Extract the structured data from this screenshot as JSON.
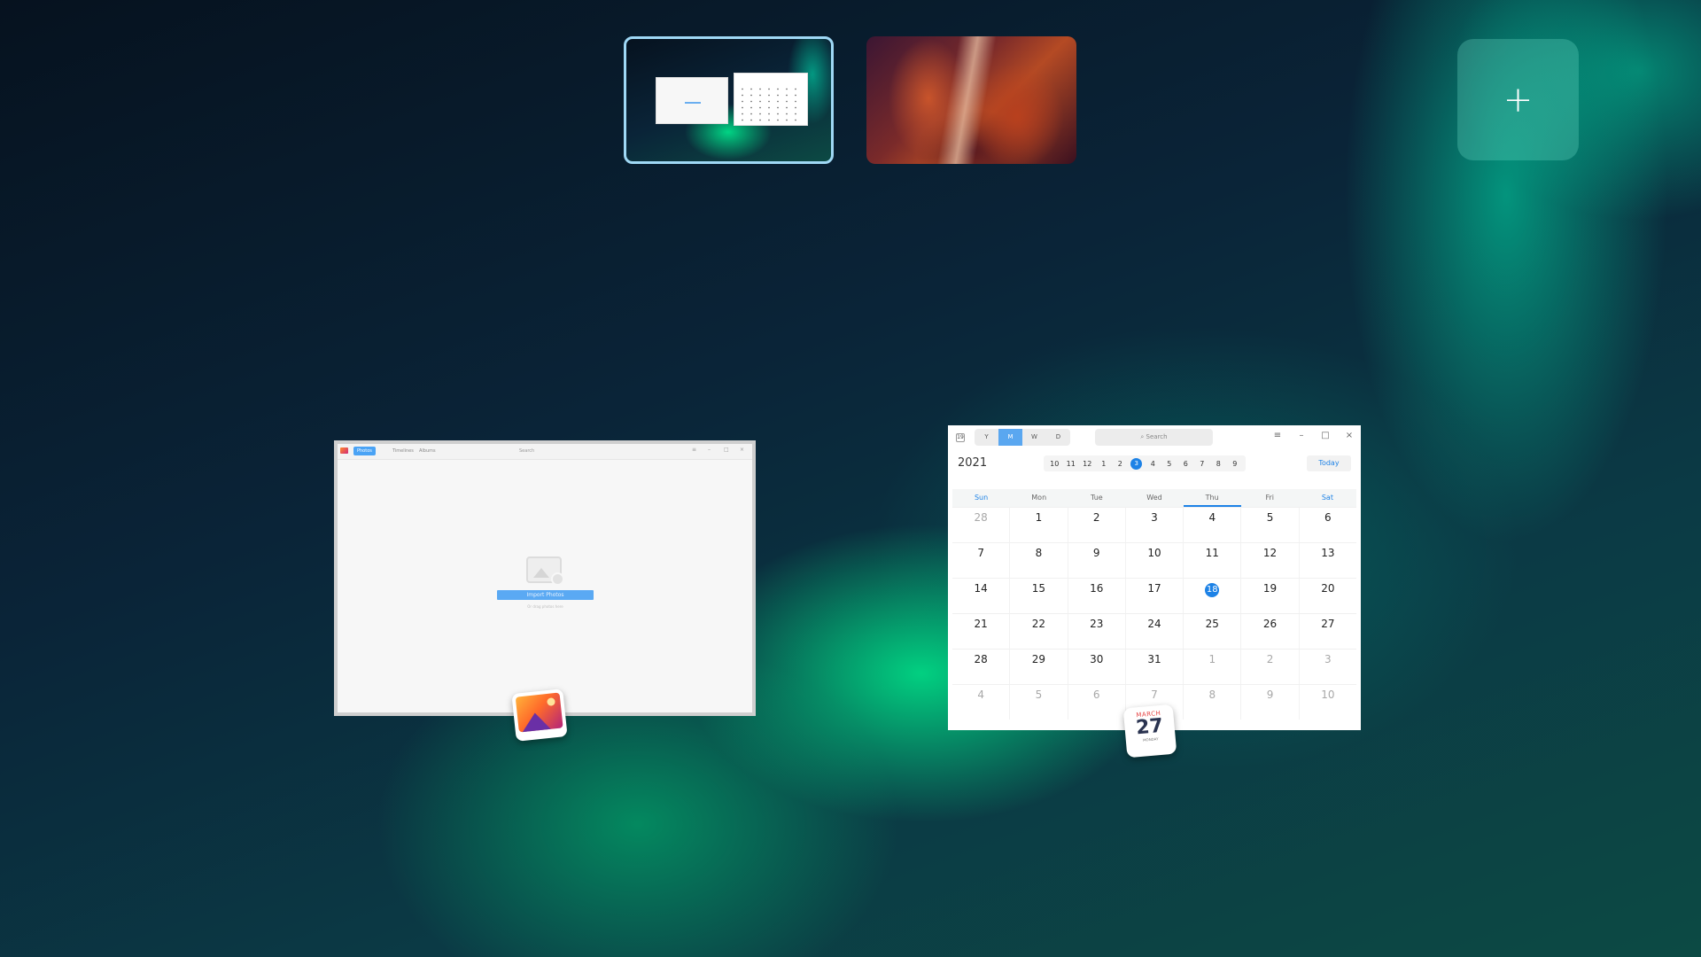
{
  "workspaces": {
    "add_label": "+"
  },
  "album": {
    "tabs": [
      "Photos",
      "Timelines",
      "Albums"
    ],
    "search_placeholder": "Search",
    "import_label": "Import Photos",
    "hint": "Or drag photos here",
    "controls": [
      "≡",
      "–",
      "□",
      "×"
    ]
  },
  "calendar": {
    "logo": "19",
    "views": [
      "Y",
      "M",
      "W",
      "D"
    ],
    "active_view": "M",
    "search_placeholder": "Search",
    "controls": [
      "≡",
      "–",
      "□",
      "×"
    ],
    "year": "2021",
    "months": [
      "10",
      "11",
      "12",
      "1",
      "2",
      "3",
      "4",
      "5",
      "6",
      "7",
      "8",
      "9"
    ],
    "active_month": "3",
    "today_label": "Today",
    "weekdays": [
      "Sun",
      "Mon",
      "Tue",
      "Wed",
      "Thu",
      "Fri",
      "Sat"
    ],
    "weeks": [
      [
        "28",
        "1",
        "2",
        "3",
        "4",
        "5",
        "6"
      ],
      [
        "7",
        "8",
        "9",
        "10",
        "11",
        "12",
        "13"
      ],
      [
        "14",
        "15",
        "16",
        "17",
        "18",
        "19",
        "20"
      ],
      [
        "21",
        "22",
        "23",
        "24",
        "25",
        "26",
        "27"
      ],
      [
        "28",
        "29",
        "30",
        "31",
        "1",
        "2",
        "3"
      ],
      [
        "4",
        "5",
        "6",
        "7",
        "8",
        "9",
        "10"
      ]
    ],
    "today_date": "18"
  },
  "calendar_icon": {
    "month": "MARCH",
    "day": "27",
    "weekday": "MONDAY"
  },
  "colors": {
    "accent": "#1d82e6",
    "selected_workspace_border": "#9fd8f5"
  },
  "icons": {
    "album_app": "album-app-icon",
    "calendar_app": "calendar-app-icon",
    "add": "plus-icon"
  }
}
